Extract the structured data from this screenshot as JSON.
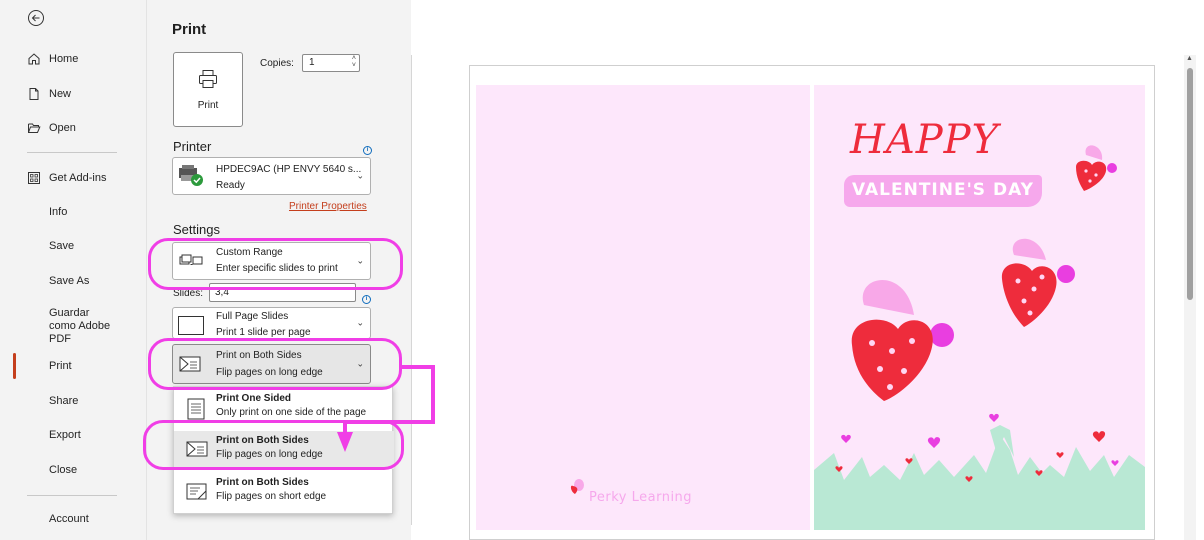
{
  "nav": {
    "items": [
      {
        "label": "Home",
        "icon": "home-icon"
      },
      {
        "label": "New",
        "icon": "new-document-icon"
      },
      {
        "label": "Open",
        "icon": "folder-open-icon"
      },
      {
        "label": "Get Add-ins",
        "icon": "add-ins-icon"
      },
      {
        "label": "Info"
      },
      {
        "label": "Save"
      },
      {
        "label": "Save As"
      },
      {
        "label": "Guardar como Adobe PDF"
      },
      {
        "label": "Print"
      },
      {
        "label": "Share"
      },
      {
        "label": "Export"
      },
      {
        "label": "Close"
      },
      {
        "label": "Account"
      }
    ],
    "active": "Print"
  },
  "print": {
    "title": "Print",
    "button_label": "Print",
    "copies_label": "Copies:",
    "copies_value": "1"
  },
  "printer": {
    "heading": "Printer",
    "name": "HPDEC9AC (HP ENVY 5640 s...",
    "status": "Ready",
    "properties_link": "Printer Properties"
  },
  "settings": {
    "heading": "Settings",
    "range": {
      "title": "Custom Range",
      "desc": "Enter specific slides to print"
    },
    "slides_label": "Slides:",
    "slides_value": "3,4",
    "layout": {
      "title": "Full Page Slides",
      "desc": "Print 1 slide per page"
    },
    "sides": {
      "title": "Print on Both Sides",
      "desc": "Flip pages on long edge"
    }
  },
  "sides_menu": [
    {
      "title": "Print One Sided",
      "desc": "Only print on one side of the page"
    },
    {
      "title": "Print on Both Sides",
      "desc": "Flip pages on long edge"
    },
    {
      "title": "Print on Both Sides",
      "desc": "Flip pages on short edge"
    }
  ],
  "preview": {
    "left_brand": "Perky Learning",
    "right_title": "HAPPY",
    "right_subtitle": "VALENTINE'S DAY"
  },
  "colors": {
    "accent": "#c43e1c",
    "annotation": "#f03ee6",
    "slide_bg": "#fde7fb",
    "heart_red": "#ee2c3c",
    "heart_pink": "#f8a8e8"
  }
}
